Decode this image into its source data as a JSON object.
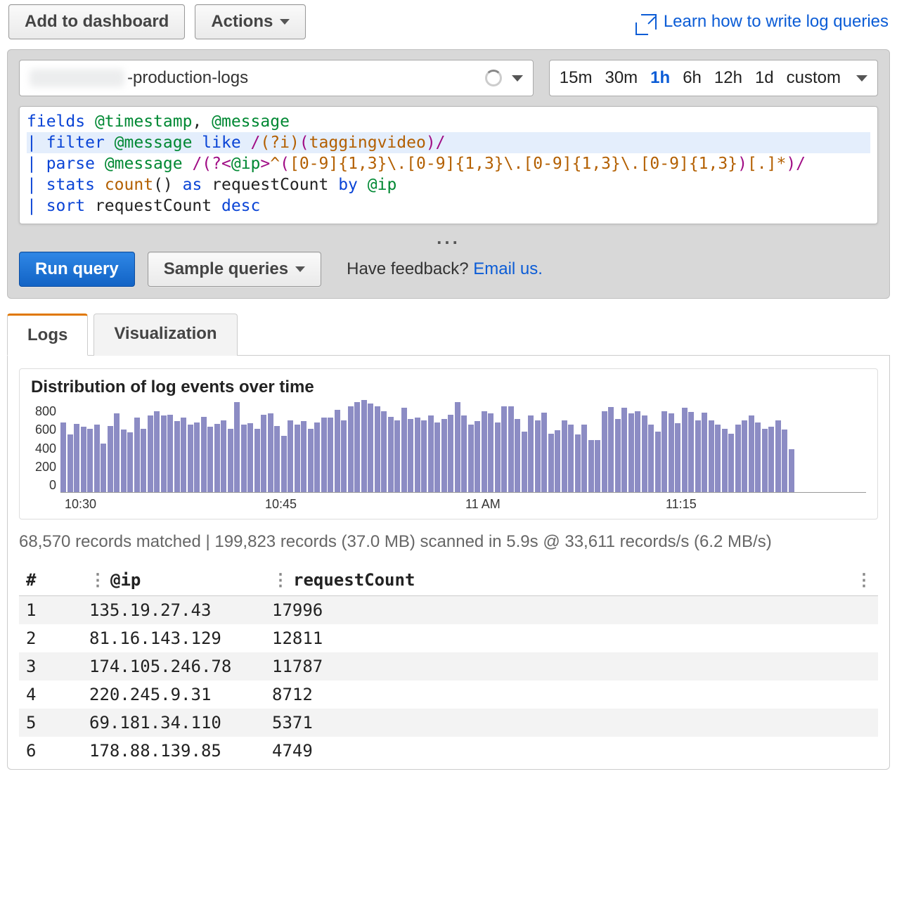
{
  "topbar": {
    "add_to_dashboard": "Add to dashboard",
    "actions": "Actions",
    "learn_link": "Learn how to write log queries"
  },
  "log_group_suffix": "-production-logs",
  "time_opts": [
    "15m",
    "30m",
    "1h",
    "6h",
    "12h",
    "1d",
    "custom"
  ],
  "time_active": "1h",
  "query_lines": [
    "fields @timestamp, @message",
    "| filter @message like /(?i)(taggingvideo)/",
    "| parse @message /(?<@ip>^([0-9]{1,3}\\.[0-9]{1,3}\\.[0-9]{1,3}\\.[0-9]{1,3})[.]*)/",
    "| stats count() as requestCount by @ip",
    "| sort requestCount desc"
  ],
  "run_query": "Run query",
  "sample_queries": "Sample queries",
  "feedback_text": "Have feedback? ",
  "feedback_link": "Email us.",
  "tabs": {
    "logs": "Logs",
    "viz": "Visualization"
  },
  "chart_data": {
    "type": "bar",
    "title": "Distribution of log events over time",
    "ylabel": "",
    "ylim": [
      0,
      800
    ],
    "yticks": [
      0,
      200,
      400,
      600,
      800
    ],
    "x_ticks": [
      "10:30",
      "10:45",
      "11 AM",
      "11:15"
    ],
    "values": [
      620,
      510,
      605,
      580,
      565,
      600,
      430,
      590,
      700,
      555,
      530,
      660,
      560,
      680,
      720,
      680,
      690,
      630,
      660,
      600,
      620,
      670,
      580,
      605,
      640,
      560,
      800,
      600,
      610,
      560,
      690,
      700,
      590,
      500,
      640,
      600,
      630,
      560,
      620,
      660,
      660,
      730,
      640,
      760,
      800,
      820,
      790,
      760,
      720,
      670,
      640,
      750,
      650,
      660,
      640,
      680,
      620,
      650,
      690,
      800,
      680,
      600,
      630,
      720,
      700,
      620,
      760,
      760,
      650,
      540,
      680,
      640,
      705,
      520,
      550,
      640,
      600,
      510,
      600,
      460,
      460,
      720,
      755,
      650,
      750,
      700,
      720,
      680,
      600,
      540,
      720,
      700,
      610,
      750,
      710,
      640,
      705,
      640,
      600,
      560,
      520,
      600,
      640,
      680,
      620,
      560,
      580,
      640,
      555,
      380
    ]
  },
  "scan_summary": "68,570 records matched | 199,823 records (37.0 MB) scanned in 5.9s @ 33,611 records/s (6.2 MB/s)",
  "columns": [
    "#",
    "@ip",
    "requestCount"
  ],
  "rows": [
    {
      "n": 1,
      "ip": "135.19.27.43",
      "count": "17996"
    },
    {
      "n": 2,
      "ip": "81.16.143.129",
      "count": "12811"
    },
    {
      "n": 3,
      "ip": "174.105.246.78",
      "count": "11787"
    },
    {
      "n": 4,
      "ip": "220.245.9.31",
      "count": "8712"
    },
    {
      "n": 5,
      "ip": "69.181.34.110",
      "count": "5371"
    },
    {
      "n": 6,
      "ip": "178.88.139.85",
      "count": "4749"
    }
  ]
}
